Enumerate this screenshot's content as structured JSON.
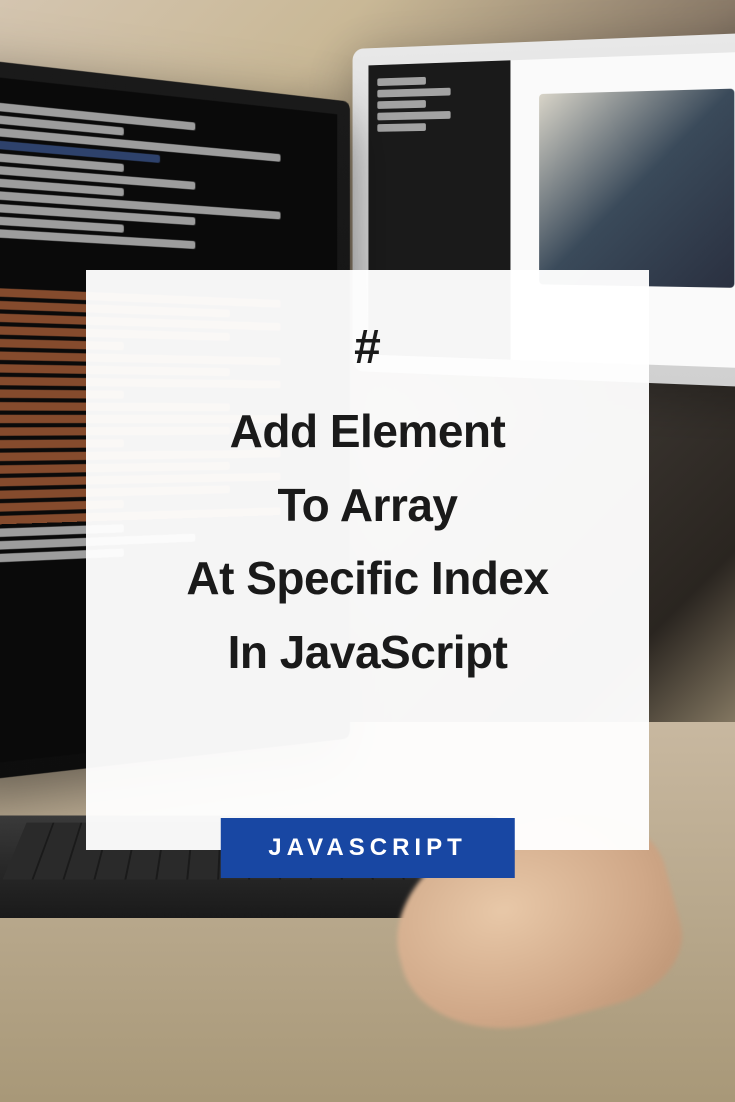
{
  "card": {
    "hash": "#",
    "line1": "Add Element",
    "line2": "To Array",
    "line3": "At Specific Index",
    "line4": "In JavaScript"
  },
  "badge": {
    "label": "JAVASCRIPT"
  }
}
